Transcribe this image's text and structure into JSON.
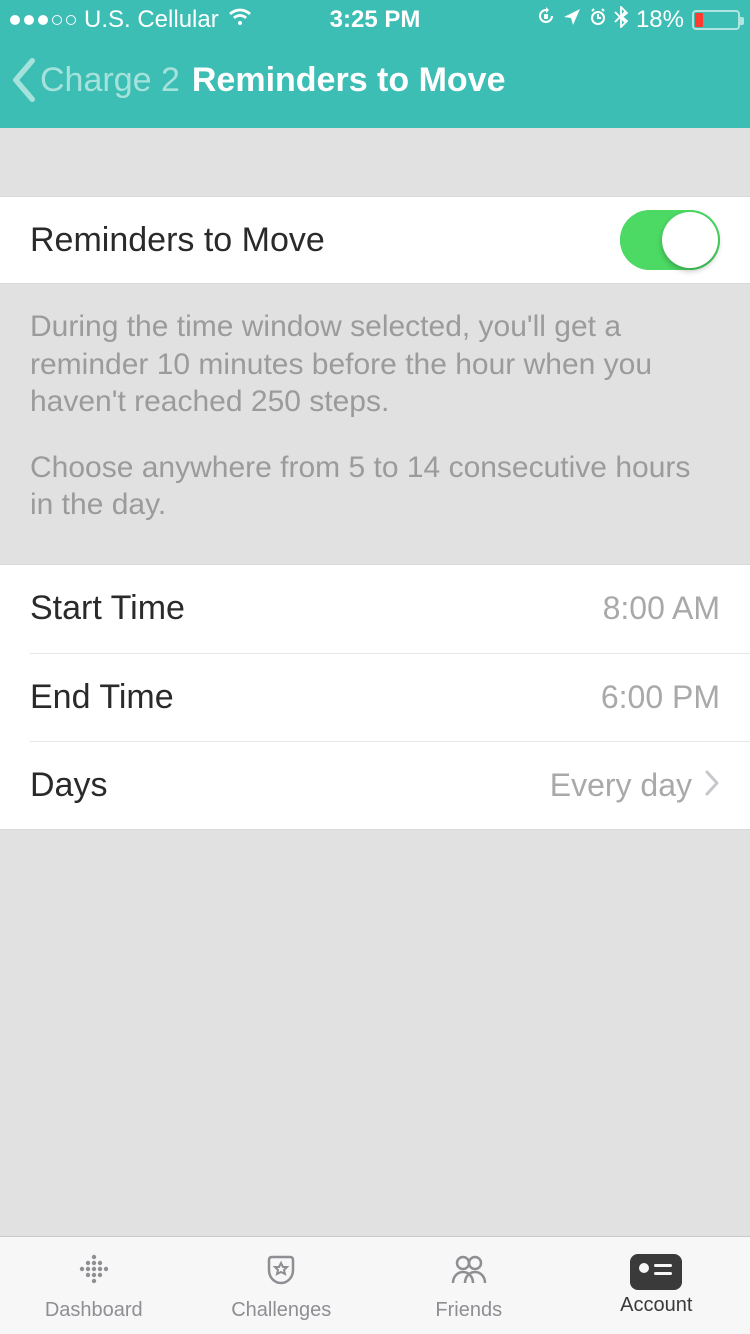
{
  "statusbar": {
    "carrier": "U.S. Cellular",
    "time": "3:25 PM",
    "battery_percent": "18%"
  },
  "nav": {
    "back_label": "Charge 2",
    "title": "Reminders to Move"
  },
  "toggle_row": {
    "label": "Reminders to Move",
    "enabled": true
  },
  "description": {
    "p1": "During the time window selected, you'll get a reminder 10 minutes before the hour when you haven't reached 250 steps.",
    "p2": "Choose anywhere from 5 to 14 consecutive hours in the day."
  },
  "rows": {
    "start_time": {
      "label": "Start Time",
      "value": "8:00 AM"
    },
    "end_time": {
      "label": "End Time",
      "value": "6:00 PM"
    },
    "days": {
      "label": "Days",
      "value": "Every day"
    }
  },
  "tabs": {
    "dashboard": "Dashboard",
    "challenges": "Challenges",
    "friends": "Friends",
    "account": "Account"
  },
  "colors": {
    "accent": "#3CBEB4",
    "toggle_on": "#4CD964"
  }
}
